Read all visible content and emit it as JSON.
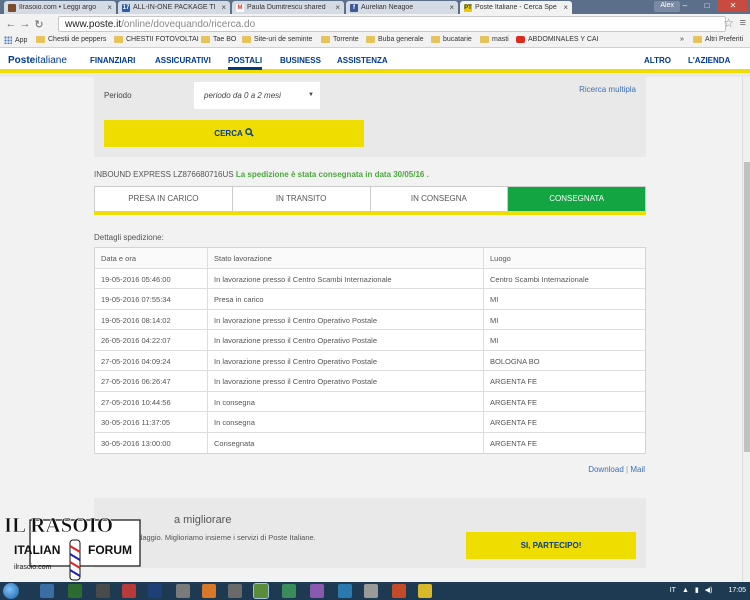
{
  "browser": {
    "tabs": [
      {
        "label": "Ilrasoio.com • Leggi argo",
        "favicon_color": "#7a4a2a",
        "favicon_text": ""
      },
      {
        "label": "ALL-IN-ONE PACKAGE TI",
        "favicon_color": "#2a5fa8",
        "favicon_text": "17"
      },
      {
        "label": "Paula Dumitrescu shared",
        "favicon_color": "#d93025",
        "favicon_text": "M"
      },
      {
        "label": "Aurelian Neagoe",
        "favicon_color": "#3b5998",
        "favicon_text": "f"
      },
      {
        "label": "Poste Italiane - Cerca Spe",
        "favicon_color": "#f0c800",
        "favicon_text": "PT"
      }
    ],
    "user": "Alex",
    "url_host": "www.poste.it",
    "url_path": "/online/dovequando/ricerca.do",
    "bookmarks": [
      {
        "label": "App",
        "icon": "apps-grid-icon"
      },
      {
        "label": "Chestii de peppers",
        "icon": "folder-icon"
      },
      {
        "label": "CHESTII FOTOVOLTAI",
        "icon": "folder-icon"
      },
      {
        "label": "Tae BO",
        "icon": "folder-icon"
      },
      {
        "label": "Site-uri de seminte",
        "icon": "folder-icon"
      },
      {
        "label": "Torrente",
        "icon": "folder-icon"
      },
      {
        "label": "Buba generale",
        "icon": "folder-icon"
      },
      {
        "label": "bucatarie",
        "icon": "folder-icon"
      },
      {
        "label": "masti",
        "icon": "folder-icon"
      },
      {
        "label": "ABDOMINALES Y CAI",
        "icon": "youtube-icon"
      }
    ],
    "bookmarks_more": "»",
    "bookmarks_other": "Altri Preferiti"
  },
  "site": {
    "logo_bold": "Poste",
    "logo_thin": "italiane",
    "nav_left": [
      "FINANZIARI",
      "ASSICURATIVI",
      "POSTALI",
      "BUSINESS",
      "ASSISTENZA"
    ],
    "nav_active": "POSTALI",
    "nav_right": [
      "ALTRO",
      "L'AZIENDA"
    ]
  },
  "form": {
    "period_label": "Periodo",
    "period_value": "periodo da 0 a 2 mesi",
    "multi_search_link": "Ricerca multipla",
    "search_button": "CERCA"
  },
  "shipment": {
    "code_prefix": "INBOUND EXPRESS LZ876680716US",
    "status_text": "La spedizione è stata consegnata in data 30/05/16 .",
    "steps": [
      "PRESA IN CARICO",
      "IN TRANSITO",
      "IN CONSEGNA",
      "CONSEGNATA"
    ],
    "current_step": "CONSEGNATA",
    "details_label": "Dettagli spedizione:",
    "columns": [
      "Data e ora",
      "Stato lavorazione",
      "Luogo"
    ],
    "rows": [
      [
        "19-05-2016 05:46:00",
        "In lavorazione presso il Centro Scambi Internazionale",
        "Centro Scambi Internazionale"
      ],
      [
        "19-05-2016 07:55:34",
        "Presa in carico",
        "MI"
      ],
      [
        "19-05-2016 08:14:02",
        "In lavorazione presso il Centro Operativo Postale",
        "MI"
      ],
      [
        "26-05-2016 04:22:07",
        "In lavorazione presso il Centro Operativo Postale",
        "MI"
      ],
      [
        "27-05-2016 04:09:24",
        "In lavorazione presso il Centro Operativo Postale",
        "BOLOGNA BO"
      ],
      [
        "27-05-2016 06:26:47",
        "In lavorazione presso il Centro Operativo Postale",
        "ARGENTA FE"
      ],
      [
        "27-05-2016 10:44:56",
        "In consegna",
        "ARGENTA FE"
      ],
      [
        "30-05-2016 11:37:05",
        "In consegna",
        "ARGENTA FE"
      ],
      [
        "30-05-2016 13:00:00",
        "Consegnata",
        "ARGENTA FE"
      ]
    ],
    "download_link": "Download",
    "mail_link": "Mail",
    "link_separator": "|"
  },
  "survey": {
    "title_visible": "a migliorare",
    "text_visible": "ndaggio. Miglioriamo insieme i servizi di Poste Italiane.",
    "button": "SI, PARTECIPO!"
  },
  "watermark": {
    "line1": "IL RASOIO",
    "line2": "ITALIAN",
    "line3": "FORUM",
    "site": "ilrasoio.com"
  },
  "taskbar": {
    "lang": "IT",
    "time": "17:05"
  },
  "colors": {
    "brand_blue": "#003a8c",
    "brand_yellow": "#f0dd00",
    "delivered_green": "#13a541"
  }
}
